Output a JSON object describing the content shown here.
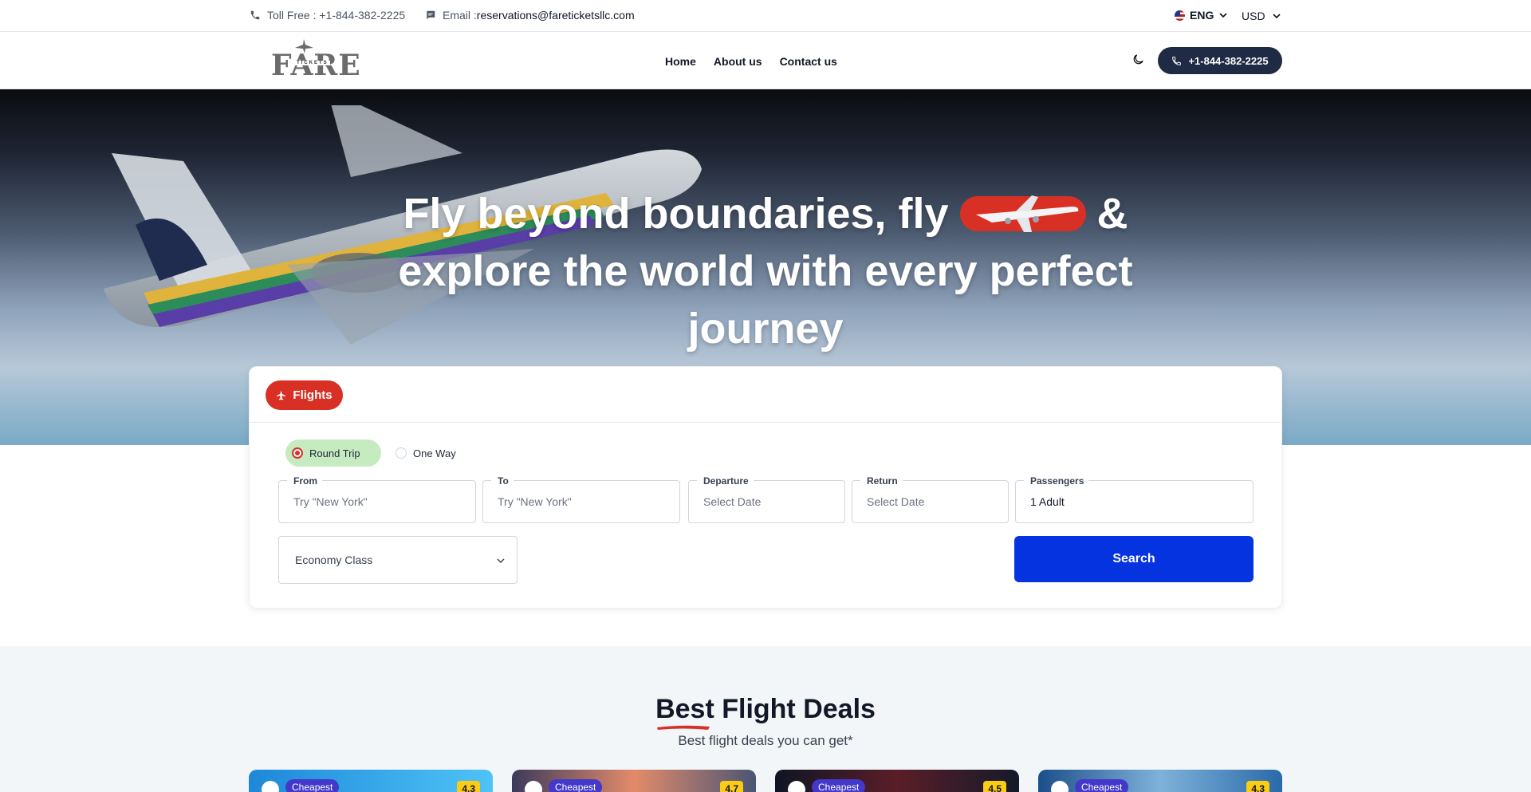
{
  "topbar": {
    "toll_free": "Toll Free : +1-844-382-2225",
    "email_label": "Email :",
    "email_value": "reservations@fareticketsllc.com",
    "language": "ENG",
    "currency": "USD"
  },
  "nav": {
    "logo_word": "FARE",
    "logo_sub": "TICKETS",
    "links": [
      "Home",
      "About us",
      "Contact us"
    ],
    "phone_button": "+1-844-382-2225"
  },
  "hero": {
    "title_part1": "Fly beyond boundaries, fly",
    "title_part2": "&",
    "title_part3": "explore the world with every perfect journey"
  },
  "search": {
    "tab_label": "Flights",
    "trip_types": [
      "Round Trip",
      "One Way"
    ],
    "selected_trip": "Round Trip",
    "fields": {
      "from": {
        "label": "From",
        "placeholder": "Try \"New York\""
      },
      "to": {
        "label": "To",
        "placeholder": "Try \"New York\""
      },
      "departure": {
        "label": "Departure",
        "placeholder": "Select Date"
      },
      "return": {
        "label": "Return",
        "placeholder": "Select Date"
      },
      "passengers": {
        "label": "Passengers",
        "value": "1 Adult"
      }
    },
    "cabin_class": "Economy Class",
    "search_button": "Search"
  },
  "deals": {
    "title_first": "Best",
    "title_rest": " Flight Deals",
    "subtitle": "Best flight deals you can get*",
    "cards": [
      {
        "tag": "Cheapest",
        "rating": "4.3"
      },
      {
        "tag": "Cheapest",
        "rating": "4.7"
      },
      {
        "tag": "Cheapest",
        "rating": "4.5"
      },
      {
        "tag": "Cheapest",
        "rating": "4.3"
      }
    ]
  },
  "colors": {
    "brand_red": "#d93025",
    "search_blue": "#0633e0",
    "nav_dark": "#1f2a44",
    "deal_tag": "#4338ca"
  }
}
